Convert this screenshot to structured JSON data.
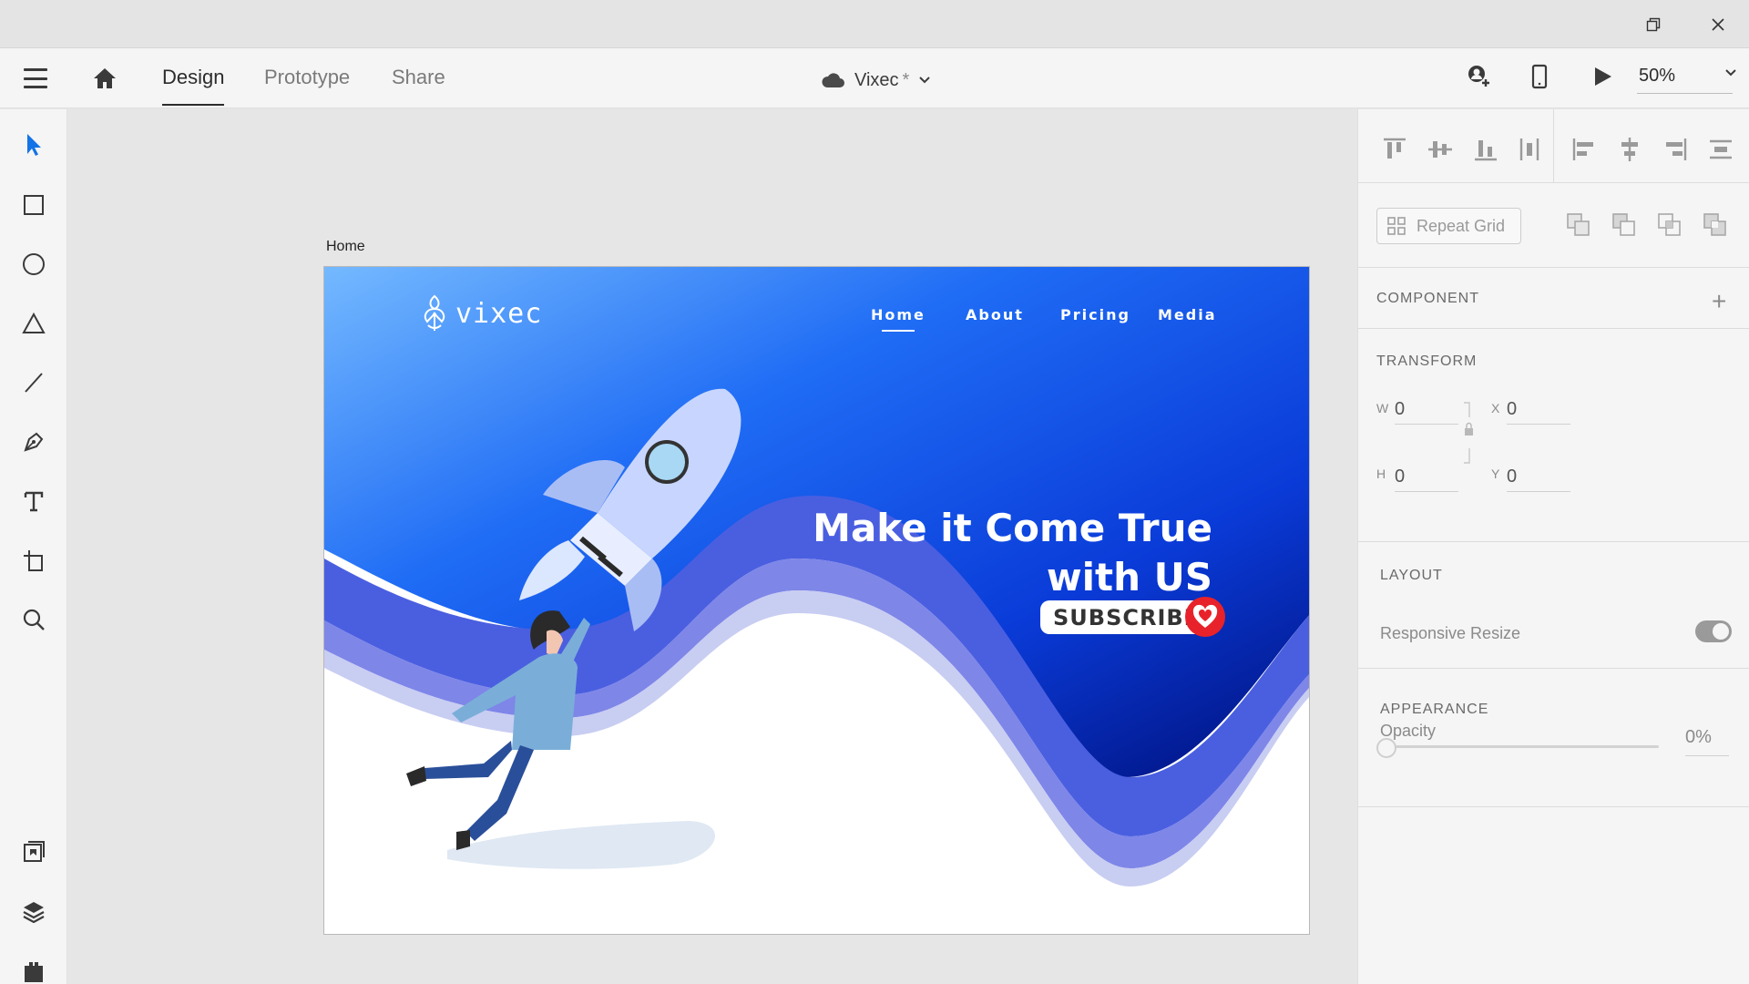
{
  "tabs": [
    {
      "label": "Design",
      "active": true
    },
    {
      "label": "Prototype",
      "active": false
    },
    {
      "label": "Share",
      "active": false
    }
  ],
  "document": {
    "title": "Vixec",
    "unsaved_mark": "*"
  },
  "zoom": {
    "value": "50%"
  },
  "artboard": {
    "label": "Home"
  },
  "hero": {
    "logo_text": "vixec",
    "nav": [
      "Home",
      "About",
      "Pricing",
      "Media"
    ],
    "active_nav": "Home",
    "headline_line1": "Make it Come True",
    "headline_line2": "with US",
    "subscribe_label": "SUBSCRIBE"
  },
  "panel": {
    "repeat_grid_label": "Repeat Grid",
    "component_title": "COMPONENT",
    "transform_title": "TRANSFORM",
    "transform": {
      "w_label": "W",
      "w_value": "0",
      "x_label": "X",
      "x_value": "0",
      "h_label": "H",
      "h_value": "0",
      "y_label": "Y",
      "y_value": "0"
    },
    "layout_title": "LAYOUT",
    "responsive_resize_label": "Responsive Resize",
    "responsive_resize_on": true,
    "appearance_title": "APPEARANCE",
    "opacity_label": "Opacity",
    "opacity_value": "0%"
  },
  "colors": {
    "accent": "#1473e6",
    "hero_blue_light": "#74b9ff",
    "hero_blue": "#1a5cf0",
    "hero_navy": "#001a8a",
    "wave": "#4a5fe0",
    "heart_red": "#e8222a"
  }
}
